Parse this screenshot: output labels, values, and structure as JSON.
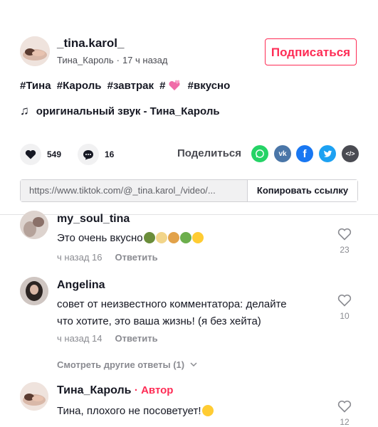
{
  "header": {
    "username": "_tina.karol_",
    "display_name": "Тина_Кароль",
    "time_ago": "17 ч назад",
    "follow_label": "Подписаться"
  },
  "caption": {
    "tags": [
      "#Тина",
      "#Кароль",
      "#завтрак",
      "#",
      "#вкусно"
    ],
    "sound_icon": "music-note-icon",
    "sound": "оригинальный звук - Тина_Кароль"
  },
  "actions": {
    "likes": "549",
    "comments": "16",
    "share_label": "Поделиться"
  },
  "share_icons": [
    "whatsapp-icon",
    "vk-icon",
    "facebook-icon",
    "twitter-icon",
    "embed-icon"
  ],
  "colors": {
    "accent": "#fe2c55",
    "whatsapp": "#25d366",
    "vk": "#4a76a8",
    "facebook": "#1877f2",
    "twitter": "#1da1f2",
    "embed": "#4a4b52"
  },
  "link": {
    "url": "https://www.tiktok.com/@_tina.karol_/video/...",
    "copy_label": "Копировать ссылку"
  },
  "comments": [
    {
      "name": "my_soul_tina",
      "text": "Это очень вкусно",
      "time": "ч назад 16",
      "reply_label": "Ответить",
      "likes": "23"
    },
    {
      "name": "Angelina",
      "text": "совет от неизвестного комментатора: делайте что хотите, это ваша жизнь! (я без хейта)",
      "time": "ч назад 14",
      "reply_label": "Ответить",
      "likes": "10",
      "more_replies": "Смотреть другие ответы (1)"
    },
    {
      "name": "Тина_Кароль",
      "author_badge": "· Автор",
      "text": "Тина, плохого не посоветует!",
      "likes": "12"
    }
  ]
}
